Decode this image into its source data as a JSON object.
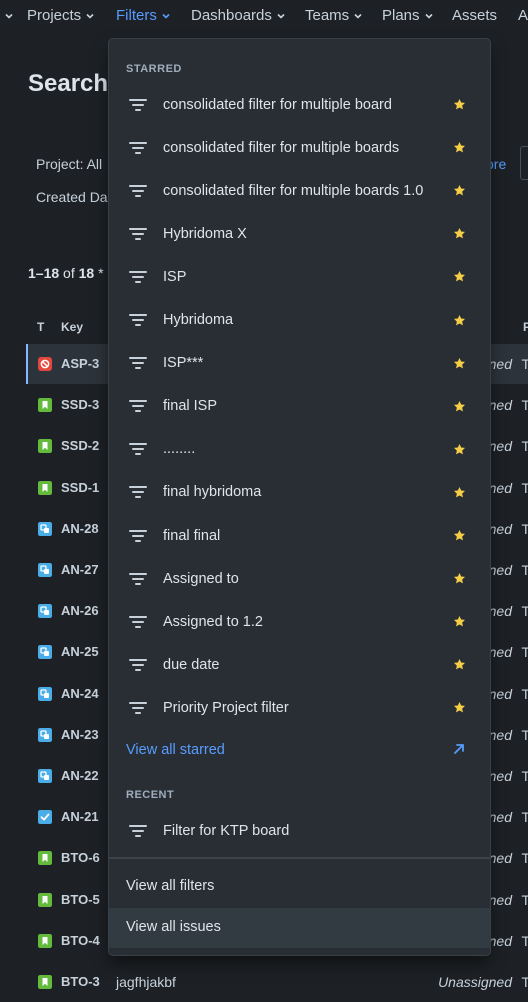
{
  "nav": {
    "items": [
      {
        "label": "Projects",
        "chevron": true,
        "active": false
      },
      {
        "label": "Filters",
        "chevron": true,
        "active": true
      },
      {
        "label": "Dashboards",
        "chevron": true,
        "active": false
      },
      {
        "label": "Teams",
        "chevron": true,
        "active": false
      },
      {
        "label": "Plans",
        "chevron": true,
        "active": false
      },
      {
        "label": "Assets",
        "chevron": false,
        "active": false
      },
      {
        "label": "A",
        "chevron": false,
        "active": false
      }
    ]
  },
  "page": {
    "title": "Search",
    "project_filter": "Project: All",
    "created_filter": "Created Da",
    "more_link": "ore",
    "results_prefix": "1–18",
    "results_mid": " of ",
    "results_total": "18",
    "results_suffix": " *",
    "columns": {
      "type": "T",
      "key": "Key",
      "last": "P"
    }
  },
  "issues": [
    {
      "type": "bug",
      "key": "ASP-3",
      "summary": "",
      "assignee": "ned",
      "last": "T",
      "selected": true
    },
    {
      "type": "story",
      "key": "SSD-3",
      "summary": "",
      "assignee": "ned",
      "last": "T"
    },
    {
      "type": "story",
      "key": "SSD-2",
      "summary": "",
      "assignee": "ned",
      "last": "T"
    },
    {
      "type": "story",
      "key": "SSD-1",
      "summary": "",
      "assignee": "ned",
      "last": "T"
    },
    {
      "type": "subtask",
      "key": "AN-28",
      "summary": "",
      "assignee": "ned",
      "last": "T"
    },
    {
      "type": "subtask",
      "key": "AN-27",
      "summary": "",
      "assignee": "ned",
      "last": "T"
    },
    {
      "type": "subtask",
      "key": "AN-26",
      "summary": "",
      "assignee": "ned",
      "last": "T"
    },
    {
      "type": "subtask",
      "key": "AN-25",
      "summary": "",
      "assignee": "ned",
      "last": "T"
    },
    {
      "type": "subtask",
      "key": "AN-24",
      "summary": "",
      "assignee": "ned",
      "last": "T"
    },
    {
      "type": "subtask",
      "key": "AN-23",
      "summary": "",
      "assignee": "ned",
      "last": "T"
    },
    {
      "type": "subtask",
      "key": "AN-22",
      "summary": "",
      "assignee": "ned",
      "last": "T"
    },
    {
      "type": "task",
      "key": "AN-21",
      "summary": "",
      "assignee": "ned",
      "last": "T"
    },
    {
      "type": "story",
      "key": "BTO-6",
      "summary": "",
      "assignee": "ned",
      "last": "T"
    },
    {
      "type": "story",
      "key": "BTO-5",
      "summary": "",
      "assignee": "ned",
      "last": "T"
    },
    {
      "type": "story",
      "key": "BTO-4",
      "summary": "",
      "assignee": "ned",
      "last": "T"
    },
    {
      "type": "story",
      "key": "BTO-3",
      "summary": "jagfhjakbf",
      "assignee": "Unassigned",
      "last": "T"
    }
  ],
  "dropdown": {
    "starred_label": "STARRED",
    "starred": [
      "consolidated filter for multiple board",
      "consolidated filter for multiple boards",
      "consolidated filter for multiple boards 1.0",
      "Hybridoma X",
      "ISP",
      "Hybridoma",
      "ISP***",
      "final ISP",
      "........",
      "final hybridoma",
      "final final",
      "Assigned to",
      "Assigned to 1.2",
      "due date",
      "Priority Project filter"
    ],
    "view_all_starred": "View all starred",
    "recent_label": "RECENT",
    "recent": [
      "Filter for KTP board"
    ],
    "view_all_filters": "View all filters",
    "view_all_issues": "View all issues"
  },
  "colors": {
    "background": "#1d2125",
    "menu": "#282e33",
    "link": "#579dff",
    "star": "#f5cd47",
    "bug": "#e2483d",
    "story": "#63ba3c",
    "subtask": "#4bade8",
    "task": "#4bade8"
  }
}
